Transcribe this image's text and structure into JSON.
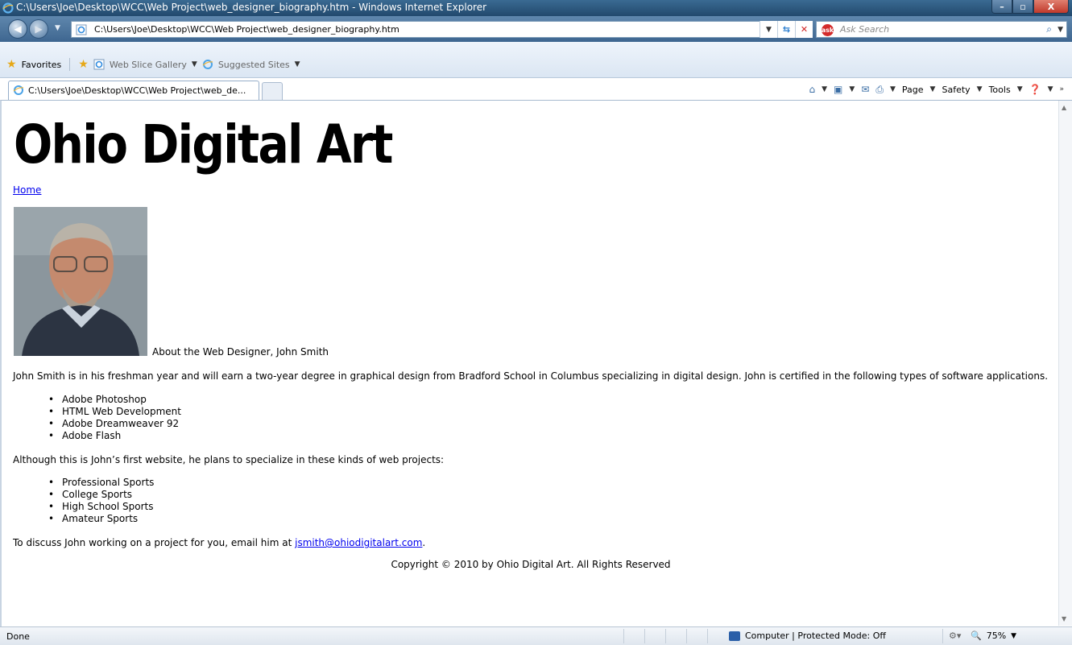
{
  "window": {
    "title": "C:\\Users\\Joe\\Desktop\\WCC\\Web Project\\web_designer_biography.htm - Windows Internet Explorer",
    "minimize": "–",
    "maximize": "▫",
    "close": "X"
  },
  "address_bar": {
    "url": "C:\\Users\\Joe\\Desktop\\WCC\\Web Project\\web_designer_biography.htm",
    "search_placeholder": "Ask Search",
    "search_brand": "ask"
  },
  "favorites_bar": {
    "favorites_label": "Favorites",
    "web_slice_label": "Web Slice Gallery",
    "suggested_label": "Suggested Sites"
  },
  "tab": {
    "label": "C:\\Users\\Joe\\Desktop\\WCC\\Web Project\\web_de..."
  },
  "command_bar": {
    "page": "Page",
    "safety": "Safety",
    "tools": "Tools"
  },
  "page": {
    "site_title": "Ohio Digital Art",
    "home_link": "Home",
    "photo_caption": "About the Web Designer, John Smith",
    "bio": "John Smith is in his freshman year and will earn a two-year degree in graphical design from Bradford School in Columbus specializing in digital design.  John is certified in the following types of software applications.",
    "certifications": [
      "Adobe Photoshop",
      "HTML Web Development",
      "Adobe Dreamweaver 92",
      "Adobe Flash"
    ],
    "plans_intro": "Although this is John’s first website, he plans to specialize in these kinds of web projects:",
    "projects": [
      "Professional Sports",
      "College Sports",
      "High School Sports",
      "Amateur Sports"
    ],
    "contact_prefix": "To discuss John working on a project for you, email him at ",
    "contact_email": "jsmith@ohiodigitalart.com",
    "contact_suffix": ".",
    "copyright": "Copyright © 2010 by Ohio Digital Art.  All Rights Reserved"
  },
  "status_bar": {
    "status": "Done",
    "zone": "Computer | Protected Mode: Off",
    "zoom": "75%"
  },
  "colors": {
    "link": "#0000ee",
    "titlebar": "#2f5c84"
  }
}
